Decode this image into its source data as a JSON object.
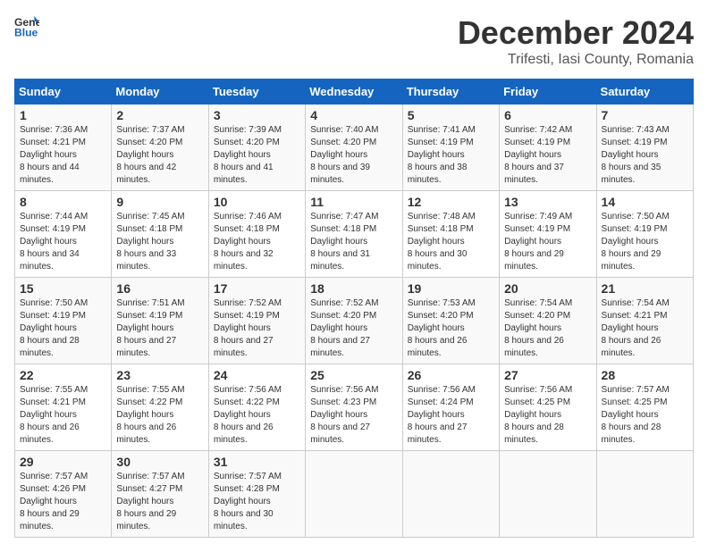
{
  "header": {
    "logo_general": "General",
    "logo_blue": "Blue",
    "month": "December 2024",
    "location": "Trifesti, Iasi County, Romania"
  },
  "days_of_week": [
    "Sunday",
    "Monday",
    "Tuesday",
    "Wednesday",
    "Thursday",
    "Friday",
    "Saturday"
  ],
  "weeks": [
    [
      {
        "day": 1,
        "sunrise": "7:36 AM",
        "sunset": "4:21 PM",
        "daylight": "8 hours and 44 minutes."
      },
      {
        "day": 2,
        "sunrise": "7:37 AM",
        "sunset": "4:20 PM",
        "daylight": "8 hours and 42 minutes."
      },
      {
        "day": 3,
        "sunrise": "7:39 AM",
        "sunset": "4:20 PM",
        "daylight": "8 hours and 41 minutes."
      },
      {
        "day": 4,
        "sunrise": "7:40 AM",
        "sunset": "4:20 PM",
        "daylight": "8 hours and 39 minutes."
      },
      {
        "day": 5,
        "sunrise": "7:41 AM",
        "sunset": "4:19 PM",
        "daylight": "8 hours and 38 minutes."
      },
      {
        "day": 6,
        "sunrise": "7:42 AM",
        "sunset": "4:19 PM",
        "daylight": "8 hours and 37 minutes."
      },
      {
        "day": 7,
        "sunrise": "7:43 AM",
        "sunset": "4:19 PM",
        "daylight": "8 hours and 35 minutes."
      }
    ],
    [
      {
        "day": 8,
        "sunrise": "7:44 AM",
        "sunset": "4:19 PM",
        "daylight": "8 hours and 34 minutes."
      },
      {
        "day": 9,
        "sunrise": "7:45 AM",
        "sunset": "4:18 PM",
        "daylight": "8 hours and 33 minutes."
      },
      {
        "day": 10,
        "sunrise": "7:46 AM",
        "sunset": "4:18 PM",
        "daylight": "8 hours and 32 minutes."
      },
      {
        "day": 11,
        "sunrise": "7:47 AM",
        "sunset": "4:18 PM",
        "daylight": "8 hours and 31 minutes."
      },
      {
        "day": 12,
        "sunrise": "7:48 AM",
        "sunset": "4:18 PM",
        "daylight": "8 hours and 30 minutes."
      },
      {
        "day": 13,
        "sunrise": "7:49 AM",
        "sunset": "4:19 PM",
        "daylight": "8 hours and 29 minutes."
      },
      {
        "day": 14,
        "sunrise": "7:50 AM",
        "sunset": "4:19 PM",
        "daylight": "8 hours and 29 minutes."
      }
    ],
    [
      {
        "day": 15,
        "sunrise": "7:50 AM",
        "sunset": "4:19 PM",
        "daylight": "8 hours and 28 minutes."
      },
      {
        "day": 16,
        "sunrise": "7:51 AM",
        "sunset": "4:19 PM",
        "daylight": "8 hours and 27 minutes."
      },
      {
        "day": 17,
        "sunrise": "7:52 AM",
        "sunset": "4:19 PM",
        "daylight": "8 hours and 27 minutes."
      },
      {
        "day": 18,
        "sunrise": "7:52 AM",
        "sunset": "4:20 PM",
        "daylight": "8 hours and 27 minutes."
      },
      {
        "day": 19,
        "sunrise": "7:53 AM",
        "sunset": "4:20 PM",
        "daylight": "8 hours and 26 minutes."
      },
      {
        "day": 20,
        "sunrise": "7:54 AM",
        "sunset": "4:20 PM",
        "daylight": "8 hours and 26 minutes."
      },
      {
        "day": 21,
        "sunrise": "7:54 AM",
        "sunset": "4:21 PM",
        "daylight": "8 hours and 26 minutes."
      }
    ],
    [
      {
        "day": 22,
        "sunrise": "7:55 AM",
        "sunset": "4:21 PM",
        "daylight": "8 hours and 26 minutes."
      },
      {
        "day": 23,
        "sunrise": "7:55 AM",
        "sunset": "4:22 PM",
        "daylight": "8 hours and 26 minutes."
      },
      {
        "day": 24,
        "sunrise": "7:56 AM",
        "sunset": "4:22 PM",
        "daylight": "8 hours and 26 minutes."
      },
      {
        "day": 25,
        "sunrise": "7:56 AM",
        "sunset": "4:23 PM",
        "daylight": "8 hours and 27 minutes."
      },
      {
        "day": 26,
        "sunrise": "7:56 AM",
        "sunset": "4:24 PM",
        "daylight": "8 hours and 27 minutes."
      },
      {
        "day": 27,
        "sunrise": "7:56 AM",
        "sunset": "4:25 PM",
        "daylight": "8 hours and 28 minutes."
      },
      {
        "day": 28,
        "sunrise": "7:57 AM",
        "sunset": "4:25 PM",
        "daylight": "8 hours and 28 minutes."
      }
    ],
    [
      {
        "day": 29,
        "sunrise": "7:57 AM",
        "sunset": "4:26 PM",
        "daylight": "8 hours and 29 minutes."
      },
      {
        "day": 30,
        "sunrise": "7:57 AM",
        "sunset": "4:27 PM",
        "daylight": "8 hours and 29 minutes."
      },
      {
        "day": 31,
        "sunrise": "7:57 AM",
        "sunset": "4:28 PM",
        "daylight": "8 hours and 30 minutes."
      },
      null,
      null,
      null,
      null
    ]
  ]
}
